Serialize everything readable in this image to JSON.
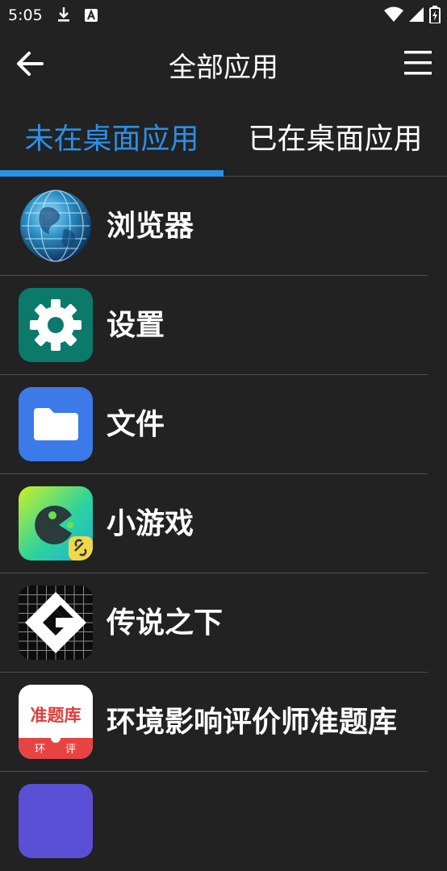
{
  "status": {
    "time": "5:05"
  },
  "header": {
    "title": "全部应用"
  },
  "tabs": [
    {
      "label": "未在桌面应用",
      "active": true
    },
    {
      "label": "已在桌面应用",
      "active": false
    }
  ],
  "apps": [
    {
      "label": "浏览器",
      "icon": "globe-icon"
    },
    {
      "label": "设置",
      "icon": "gear-icon"
    },
    {
      "label": "文件",
      "icon": "folder-icon"
    },
    {
      "label": "小游戏",
      "icon": "pacman-game-icon"
    },
    {
      "label": "传说之下",
      "icon": "gamemaker-icon"
    },
    {
      "label": "环境影响评价师准题库",
      "icon": "question-bank-icon",
      "icon_text": "准题库",
      "icon_sub": [
        "环",
        "评"
      ]
    }
  ],
  "colors": {
    "accent": "#2b8fe6",
    "background": "#222222"
  }
}
